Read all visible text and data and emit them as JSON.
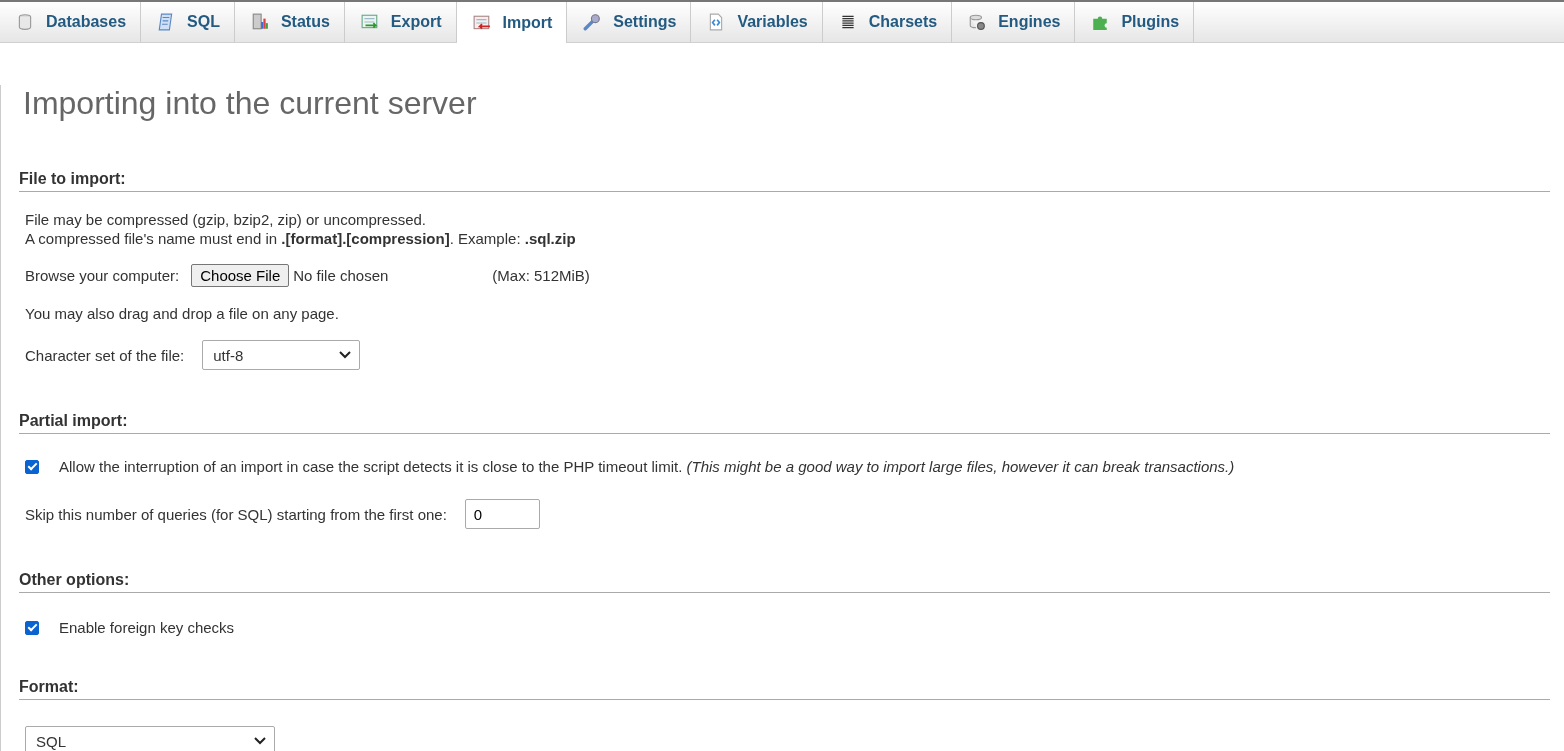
{
  "tabs": [
    {
      "label": "Databases",
      "selected": false
    },
    {
      "label": "SQL",
      "selected": false
    },
    {
      "label": "Status",
      "selected": false
    },
    {
      "label": "Export",
      "selected": false
    },
    {
      "label": "Import",
      "selected": true
    },
    {
      "label": "Settings",
      "selected": false
    },
    {
      "label": "Variables",
      "selected": false
    },
    {
      "label": "Charsets",
      "selected": false
    },
    {
      "label": "Engines",
      "selected": false
    },
    {
      "label": "Plugins",
      "selected": false
    }
  ],
  "title": "Importing into the current server",
  "file_section": {
    "heading": "File to import:",
    "note_1": "File may be compressed (gzip, bzip2, zip) or uncompressed.",
    "note_2": "A compressed file's name must end in **.[format].[compression]**. Example: **.sql.zip**",
    "browse_label": "Browse your computer:",
    "choose_button": "Choose File",
    "file_status": "No file chosen",
    "max_size": "(Max: 512MiB)",
    "drag_note": "You may also drag and drop a file on any page.",
    "charset_label": "Character set of the file:",
    "charset_value": "utf-8"
  },
  "partial_section": {
    "heading": "Partial import:",
    "allow_interrupt": {
      "checked": true,
      "label": "Allow the interruption of an import in case the script detects it is close to the PHP timeout limit.",
      "hint": "(This might be a good way to import large files, however it can break transactions.)"
    },
    "skip_label": "Skip this number of queries (for SQL) starting from the first one:",
    "skip_value": "0"
  },
  "other_section": {
    "heading": "Other options:",
    "foreign_keys": {
      "checked": true,
      "label": "Enable foreign key checks"
    }
  },
  "format_section": {
    "heading": "Format:",
    "format_value": "SQL"
  }
}
